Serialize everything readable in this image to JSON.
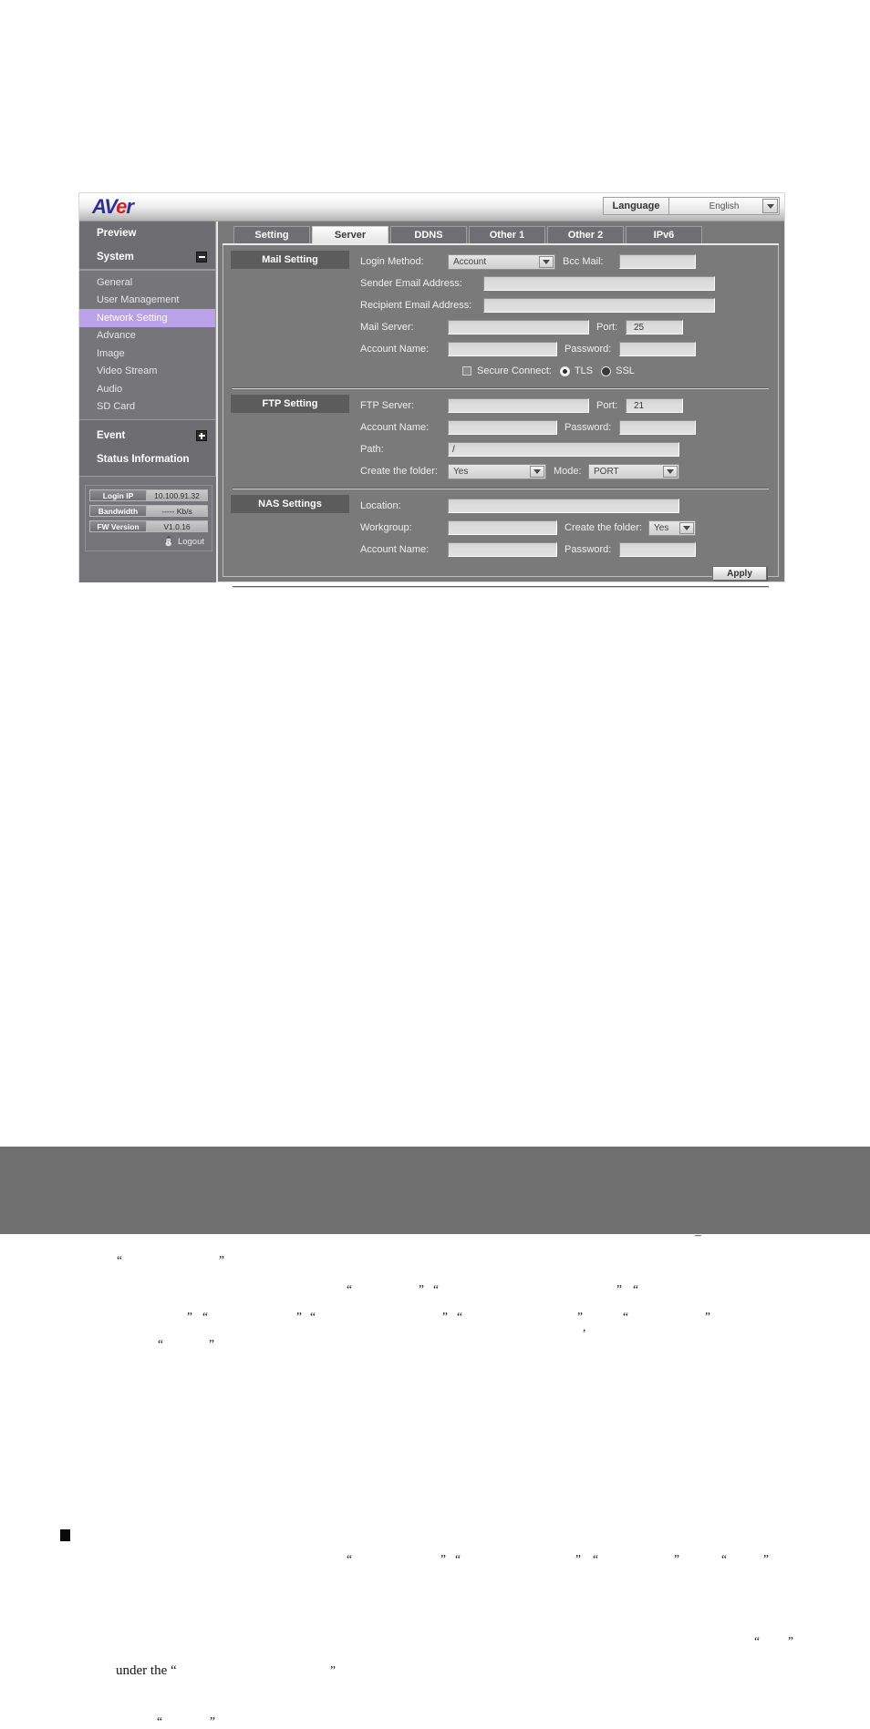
{
  "app": {
    "logo": {
      "part1": "AV",
      "part2": "e",
      "part3": "r"
    },
    "language": {
      "label": "Language",
      "selected": "English"
    }
  },
  "sidebar": {
    "main_items": [
      {
        "label": "Preview",
        "toggle": null
      },
      {
        "label": "System",
        "toggle": "minus"
      }
    ],
    "sub_items": [
      {
        "label": "General",
        "active": false
      },
      {
        "label": "User Management",
        "active": false
      },
      {
        "label": "Network Setting",
        "active": true
      },
      {
        "label": "Advance",
        "active": false
      },
      {
        "label": "Image",
        "active": false
      },
      {
        "label": "Video Stream",
        "active": false
      },
      {
        "label": "Audio",
        "active": false
      },
      {
        "label": "SD Card",
        "active": false
      }
    ],
    "bottom_items": [
      {
        "label": "Event",
        "toggle": "plus"
      },
      {
        "label": "Status Information",
        "toggle": null
      }
    ],
    "status": [
      {
        "key": "Login IP",
        "value": "10.100.91.32"
      },
      {
        "key": "Bandwidth",
        "value": "----- Kb/s"
      },
      {
        "key": "FW Version",
        "value": "V1.0.16"
      }
    ],
    "logout_label": "Logout"
  },
  "tabs": [
    {
      "label": "Setting",
      "active": false
    },
    {
      "label": "Server",
      "active": true
    },
    {
      "label": "DDNS",
      "active": false
    },
    {
      "label": "Other 1",
      "active": false
    },
    {
      "label": "Other 2",
      "active": false
    },
    {
      "label": "IPv6",
      "active": false
    }
  ],
  "mail": {
    "section_title": "Mail Setting",
    "login_method_label": "Login Method:",
    "login_method_value": "Account",
    "bcc_label": "Bcc Mail:",
    "bcc_value": "",
    "sender_label": "Sender Email Address:",
    "sender_value": "",
    "recipient_label": "Recipient Email Address:",
    "recipient_value": "",
    "mail_server_label": "Mail Server:",
    "mail_server_value": "",
    "port_label": "Port:",
    "port_value": "25",
    "account_label": "Account Name:",
    "account_value": "",
    "password_label": "Password:",
    "password_value": "",
    "secure_label": "Secure Connect:",
    "tls_label": "TLS",
    "ssl_label": "SSL"
  },
  "ftp": {
    "section_title": "FTP Setting",
    "server_label": "FTP Server:",
    "server_value": "",
    "port_label": "Port:",
    "port_value": "21",
    "account_label": "Account Name:",
    "account_value": "",
    "password_label": "Password:",
    "password_value": "",
    "path_label": "Path:",
    "path_value": "/",
    "create_folder_label": "Create the folder:",
    "create_folder_value": "Yes",
    "mode_label": "Mode:",
    "mode_value": "PORT"
  },
  "nas": {
    "section_title": "NAS Settings",
    "location_label": "Location:",
    "location_value": "",
    "workgroup_label": "Workgroup:",
    "workgroup_value": "",
    "create_folder_label": "Create the folder:",
    "create_folder_value": "Yes",
    "account_label": "Account Name:",
    "account_value": "",
    "password_label": "Password:",
    "password_value": ""
  },
  "actions": {
    "apply_label": "Apply"
  },
  "document": {
    "visible_text": "under the “",
    "visible_text_close": "”",
    "quote_open": "“",
    "quote_close": "”",
    "comma": ","
  },
  "colors": {
    "window_bg": "#787878",
    "sidebar_bg": "#757579",
    "active_nav": "#b9a2ea",
    "section_label_bg": "#5c5c5c",
    "logo_blue": "#2b2f9e",
    "logo_red": "#d32020",
    "footer_band": "#707070"
  }
}
